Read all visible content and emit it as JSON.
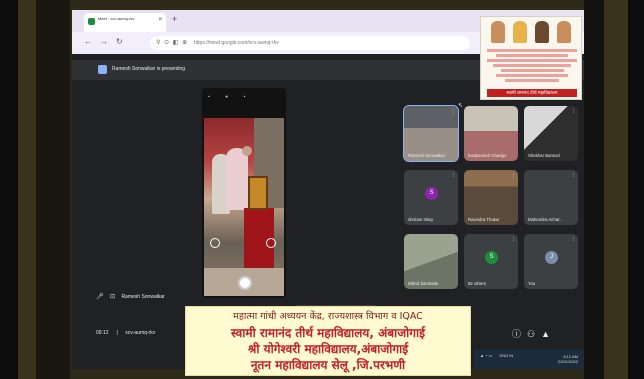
{
  "browser": {
    "tab_title": "Meet - xcv-aumq-rkv",
    "tab_close": "×",
    "new_tab": "+",
    "nav": {
      "back": "←",
      "forward": "→",
      "reload": "↻"
    },
    "url": "https://meet.google.com/xcv-aumq-rkv"
  },
  "meet": {
    "presenting_text": "Ramesh Sonwalkar is presenting",
    "self_name": "Ramesh Sonwalkar",
    "time": "09:12",
    "meeting_code": "xcv-aumq-rkv",
    "tooltip": "Ramesh Sonwalkar is",
    "participants": [
      {
        "name": "Ramesh Sonwalkar",
        "initial": "",
        "style": "t-cam1",
        "avatar_color": "",
        "speaking": true
      },
      {
        "name": "Dadasaheb Ghadge",
        "initial": "",
        "style": "t-cam2",
        "avatar_color": "",
        "speaking": false
      },
      {
        "name": "Shekhar Bansod",
        "initial": "",
        "style": "t-cam3",
        "avatar_color": "",
        "speaking": false
      },
      {
        "name": "shriram shep",
        "initial": "S",
        "style": "",
        "avatar_color": "#8e24aa",
        "speaking": false
      },
      {
        "name": "Ravindra Thakur",
        "initial": "",
        "style": "t-cam4",
        "avatar_color": "",
        "speaking": false
      },
      {
        "name": "Mahendra Achar...",
        "initial": "",
        "style": "",
        "avatar_color": "",
        "speaking": false
      },
      {
        "name": "Milind Zamkade",
        "initial": "",
        "style": "t-cam5",
        "avatar_color": "",
        "speaking": false
      },
      {
        "name": "82 others",
        "initial": "S",
        "style": "",
        "avatar_color": "#1e8e3e",
        "speaking": false
      },
      {
        "name": "You",
        "initial": "J",
        "style": "",
        "avatar_color": "#7b8fa8",
        "speaking": false
      }
    ]
  },
  "sticker": {
    "banner": "स्वामी रामानंद तीर्थ महाविद्यालय"
  },
  "taskbar": {
    "lang": "ENG IN",
    "time": "8:12 AM",
    "date": "22/01/2022"
  },
  "caption": {
    "line1": "महात्मा गांधी अध्ययन केंद्र, राज्यशास्त्र विभाग व IQAC",
    "line2": "स्वामी रामानंद तीर्थ महाविद्यालय, अंबाजोगाई",
    "line3": "श्री योगेश्वरी महाविद्यालय,अंबाजोगाई",
    "line4": "नूतन महाविद्यालय सेलू ,जि.परभणी"
  },
  "colors": {
    "meet_bg": "#202124",
    "tile_bg": "#3c4043",
    "caption_bg": "#fffad0",
    "caption_text": "#c0202a"
  }
}
